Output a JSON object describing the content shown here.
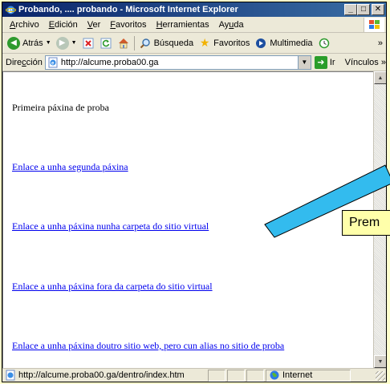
{
  "window": {
    "title": "Probando, .... probando - Microsoft Internet Explorer",
    "minimize": "_",
    "maximize": "□",
    "close": "✕"
  },
  "menubar": {
    "items": [
      {
        "u": "A",
        "rest": "rchivo"
      },
      {
        "u": "E",
        "rest": "dición"
      },
      {
        "u": "V",
        "rest": "er"
      },
      {
        "u": "F",
        "rest": "avoritos"
      },
      {
        "u": "H",
        "rest": "erramientas"
      },
      {
        "pre": "Ay",
        "u": "u",
        "rest": "da"
      }
    ]
  },
  "toolbar": {
    "back": "Atrás",
    "search": "Búsqueda",
    "favorites": "Favoritos",
    "multimedia": "Multimedia",
    "more": "»"
  },
  "address": {
    "label_pre": "Dire",
    "label_u": "c",
    "label_post": "ción",
    "url": "http://alcume.proba00.ga",
    "go": "Ir",
    "links": "Vínculos",
    "links_more": "»"
  },
  "content": {
    "heading": "Primeira páxina de proba",
    "links": [
      "Enlace a unha segunda páxina",
      "Enlace a unha páxina nunha carpeta do sitio virtual",
      "Enlace a unha páxina fora da carpeta do sitio virtual",
      "Enlace a unha páxina doutro sitio web, pero cun alias no sitio de proba"
    ]
  },
  "statusbar": {
    "url": "http://alcume.proba00.ga/dentro/index.htm",
    "zone": "Internet"
  },
  "callout": {
    "text": "Prem",
    "color": "#ffffaa",
    "arrow_color": "#33bbee"
  },
  "icons": [
    "ie-icon",
    "back-arrow-icon",
    "forward-arrow-icon",
    "stop-icon",
    "refresh-icon",
    "home-icon",
    "search-icon",
    "favorites-star-icon",
    "multimedia-icon",
    "history-icon",
    "page-icon",
    "go-arrow-icon",
    "internet-globe-icon",
    "windows-logo-icon"
  ]
}
